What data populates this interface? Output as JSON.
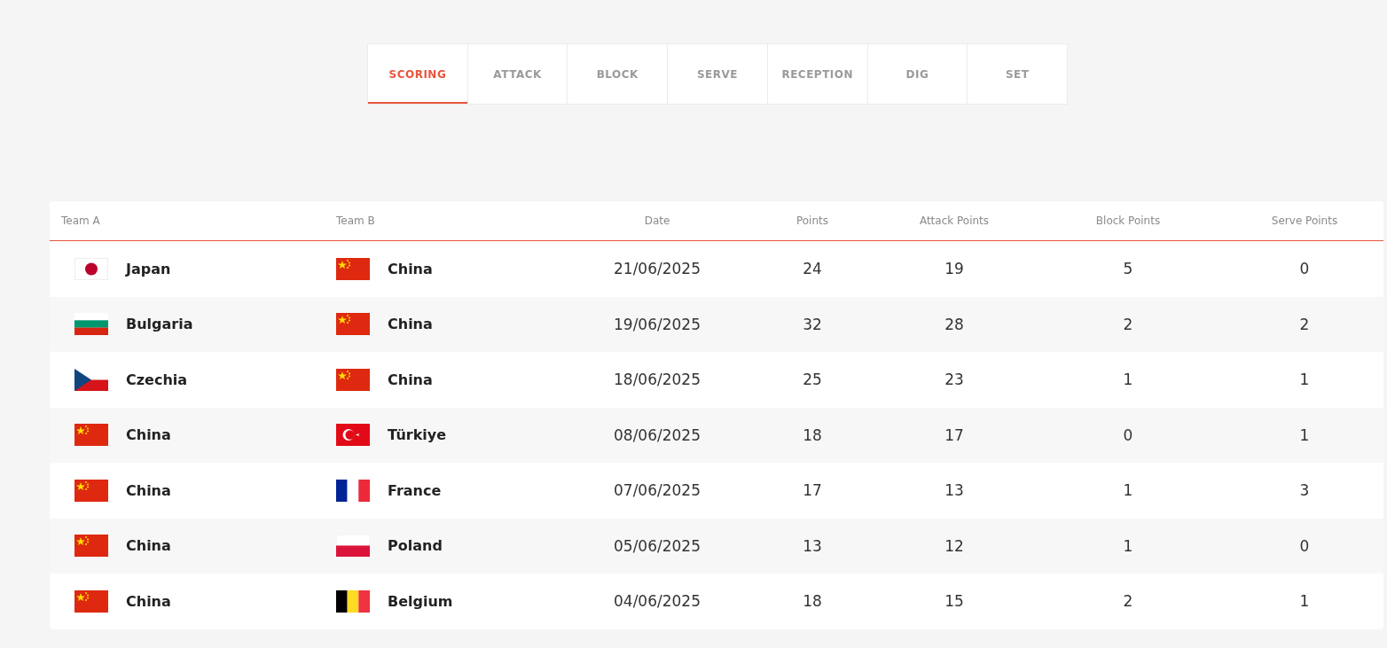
{
  "tabs": [
    {
      "label": "SCORING",
      "selected": true
    },
    {
      "label": "ATTACK",
      "selected": false
    },
    {
      "label": "BLOCK",
      "selected": false
    },
    {
      "label": "SERVE",
      "selected": false
    },
    {
      "label": "RECEPTION",
      "selected": false
    },
    {
      "label": "DIG",
      "selected": false
    },
    {
      "label": "SET",
      "selected": false
    }
  ],
  "table": {
    "columns": [
      "Team A",
      "Team B",
      "Date",
      "Points",
      "Attack Points",
      "Block Points",
      "Serve Points"
    ],
    "rows": [
      {
        "team_a": {
          "name": "Japan",
          "kind": "jp"
        },
        "team_b": {
          "name": "China",
          "kind": "cn"
        },
        "date": "21/06/2025",
        "points": "24",
        "attack_points": "19",
        "block_points": "5",
        "serve_points": "0"
      },
      {
        "team_a": {
          "name": "Bulgaria",
          "kind": "bg"
        },
        "team_b": {
          "name": "China",
          "kind": "cn"
        },
        "date": "19/06/2025",
        "points": "32",
        "attack_points": "28",
        "block_points": "2",
        "serve_points": "2"
      },
      {
        "team_a": {
          "name": "Czechia",
          "kind": "cz"
        },
        "team_b": {
          "name": "China",
          "kind": "cn"
        },
        "date": "18/06/2025",
        "points": "25",
        "attack_points": "23",
        "block_points": "1",
        "serve_points": "1"
      },
      {
        "team_a": {
          "name": "China",
          "kind": "cn"
        },
        "team_b": {
          "name": "Türkiye",
          "kind": "tr"
        },
        "date": "08/06/2025",
        "points": "18",
        "attack_points": "17",
        "block_points": "0",
        "serve_points": "1"
      },
      {
        "team_a": {
          "name": "China",
          "kind": "cn"
        },
        "team_b": {
          "name": "France",
          "kind": "fr"
        },
        "date": "07/06/2025",
        "points": "17",
        "attack_points": "13",
        "block_points": "1",
        "serve_points": "3"
      },
      {
        "team_a": {
          "name": "China",
          "kind": "cn"
        },
        "team_b": {
          "name": "Poland",
          "kind": "pl"
        },
        "date": "05/06/2025",
        "points": "13",
        "attack_points": "12",
        "block_points": "1",
        "serve_points": "0"
      },
      {
        "team_a": {
          "name": "China",
          "kind": "cn"
        },
        "team_b": {
          "name": "Belgium",
          "kind": "be"
        },
        "date": "04/06/2025",
        "points": "18",
        "attack_points": "15",
        "block_points": "2",
        "serve_points": "1"
      }
    ]
  }
}
